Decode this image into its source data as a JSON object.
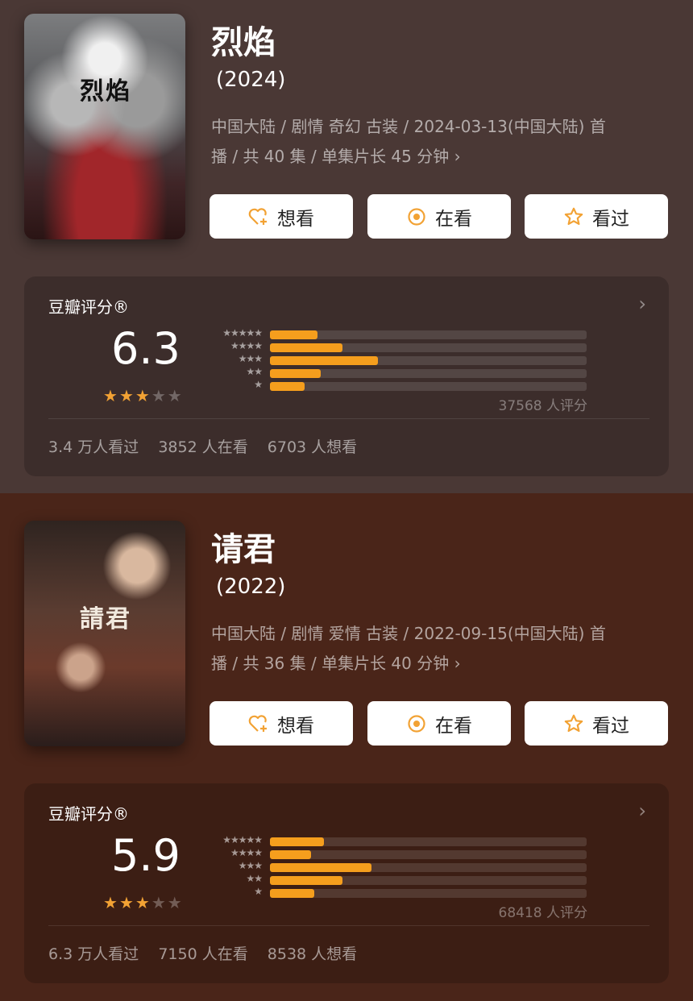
{
  "items": [
    {
      "title": "烈焰",
      "year": "(2024)",
      "poster_text": "烈焰",
      "info_line1": "中国大陆 / 剧情 奇幻 古装 / 2024-03-13(中国大陆) 首",
      "info_line2": "播 / 共 40 集 / 单集片长 45 分钟",
      "buttons": {
        "want": "想看",
        "watching": "在看",
        "watched": "看过"
      },
      "rating_label": "豆瓣评分®",
      "score": "6.3",
      "stars_filled": 3,
      "stars_total": 5,
      "distribution": [
        0.15,
        0.23,
        0.34,
        0.16,
        0.11
      ],
      "rating_count": "37568 人评分",
      "stats": {
        "watched": "3.4 万人看过",
        "watching": "3852 人在看",
        "want": "6703 人想看"
      }
    },
    {
      "title": "请君",
      "year": "(2022)",
      "poster_text": "請君",
      "info_line1": "中国大陆 / 剧情 爱情 古装 / 2022-09-15(中国大陆) 首",
      "info_line2": "播 / 共 36 集 / 单集片长 40 分钟",
      "buttons": {
        "want": "想看",
        "watching": "在看",
        "watched": "看过"
      },
      "rating_label": "豆瓣评分®",
      "score": "5.9",
      "stars_filled": 3,
      "stars_total": 5,
      "distribution": [
        0.17,
        0.13,
        0.32,
        0.23,
        0.14
      ],
      "rating_count": "68418 人评分",
      "stats": {
        "watched": "6.3 万人看过",
        "watching": "7150 人在看",
        "want": "8538 人想看"
      }
    }
  ],
  "icons": {
    "want": "heart-plus-icon",
    "watching": "target-icon",
    "watched": "star-outline-icon",
    "more": "chevron-right-icon"
  },
  "colors": {
    "accent": "#f59e1d",
    "star": "#f2a234",
    "section1_bg": "#4a3835",
    "section2_bg": "#4a2519"
  }
}
